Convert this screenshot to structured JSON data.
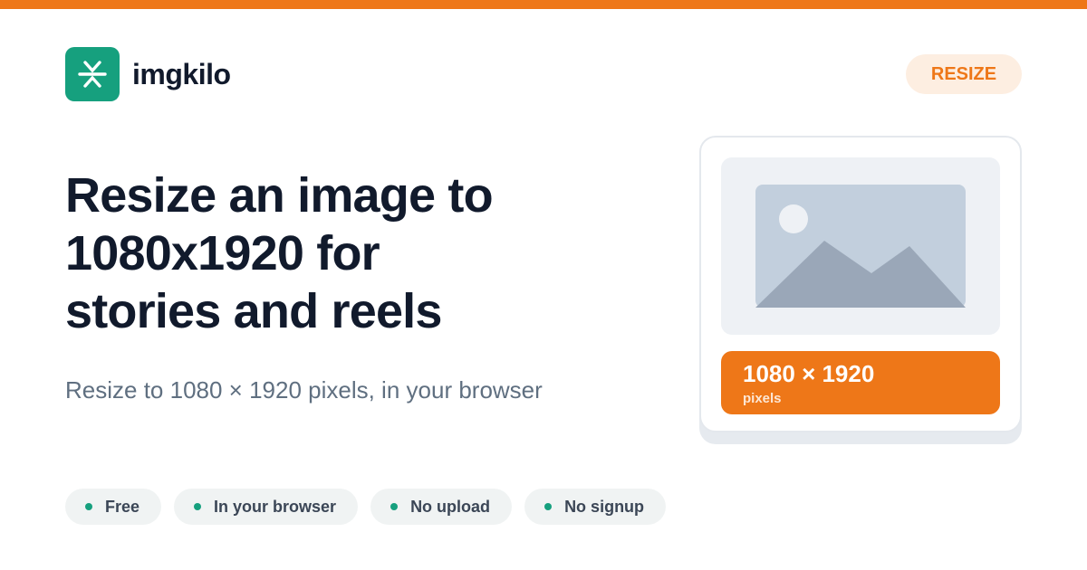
{
  "colors": {
    "accent": "#ee7718",
    "brand": "#16a07e",
    "text_dark": "#111a2c",
    "text_muted": "#5f6f80"
  },
  "brand": {
    "name": "imgkilo",
    "logo_icon": "asterisk-arrows-icon"
  },
  "tag": {
    "label": "RESIZE"
  },
  "headline": {
    "lines": [
      "Resize an image to",
      "1080x1920 for",
      "stories and reels"
    ]
  },
  "subtitle": "Resize to 1080 × 1920 pixels, in your browser",
  "features": [
    {
      "label": "Free"
    },
    {
      "label": "In your browser"
    },
    {
      "label": "No upload"
    },
    {
      "label": "No signup"
    }
  ],
  "card": {
    "preview_icon": "image-placeholder-icon",
    "size_value": "1080 × 1920",
    "size_unit": "pixels"
  }
}
